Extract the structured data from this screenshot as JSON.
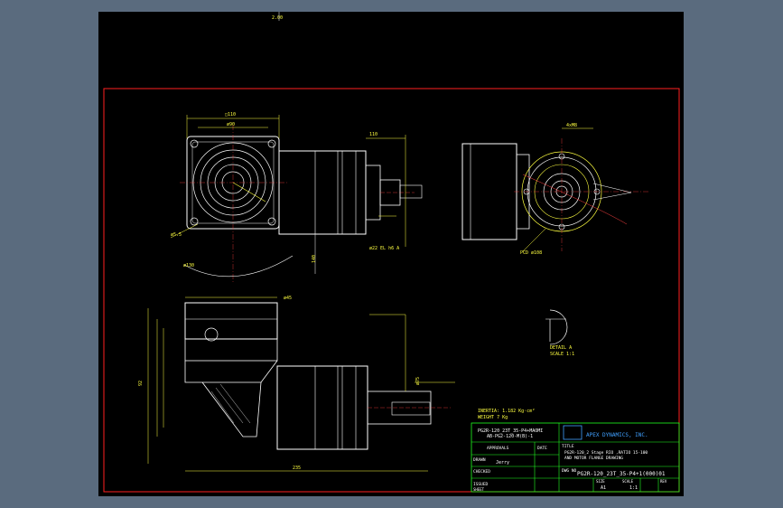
{
  "app": {
    "background_color": "#5a6b7e",
    "canvas_color": "#000000"
  },
  "drawing": {
    "colors": {
      "border": "#ff2020",
      "outline": "#ffffff",
      "dimension": "#ffff40",
      "titleblock": "#20ff20",
      "center": "#ff4040",
      "accent": "#40a0ff"
    },
    "top_mark": "2.00",
    "dims": {
      "d1": "□110",
      "d2": "ø90",
      "d3": "ø5.5",
      "d4": "ø130",
      "d5": "110",
      "d6": "4xM8",
      "d7": "ø22 EL h6 A",
      "d8": "PCD ø108",
      "d9": "ø45",
      "d10": "ø75",
      "d11": "140",
      "d12": "92",
      "d13": "235"
    },
    "detail_label": "DETAIL A",
    "detail_scale": "SCALE 1:1",
    "notes": {
      "inertia": "INERTIA: 1.182 Kg·cm²",
      "weight": "WEIGHT 7 Kg"
    },
    "title_block": {
      "part_top": "PG2R-120_23T_35-P4+MAOMI",
      "part_sub": "AB-PG2-120-M(B)-1",
      "company": "APEX DYNAMICS, INC.",
      "approved_label": "APPROVALS",
      "date_label": "DATE",
      "drawn_label": "DRAWN",
      "drawn_by": "Jerry",
      "checked_label": "CHECKED",
      "issued_label": "ISSUED",
      "title_label": "TITLE",
      "desc_line1": "PG2R-120_2 Stage RIO ,RATIO 15-100",
      "desc_line2": "AND MOTOR FLANGE DRAWING",
      "dwg_label": "DWG NO",
      "dwg_no": "PG2R-120_23T_35-P4+1(000)01",
      "size_label": "SIZE",
      "size": "A1",
      "scale_label": "SCALE",
      "scale": "1:1",
      "rev_label": "REV",
      "sheet_label": "SHEET"
    }
  }
}
